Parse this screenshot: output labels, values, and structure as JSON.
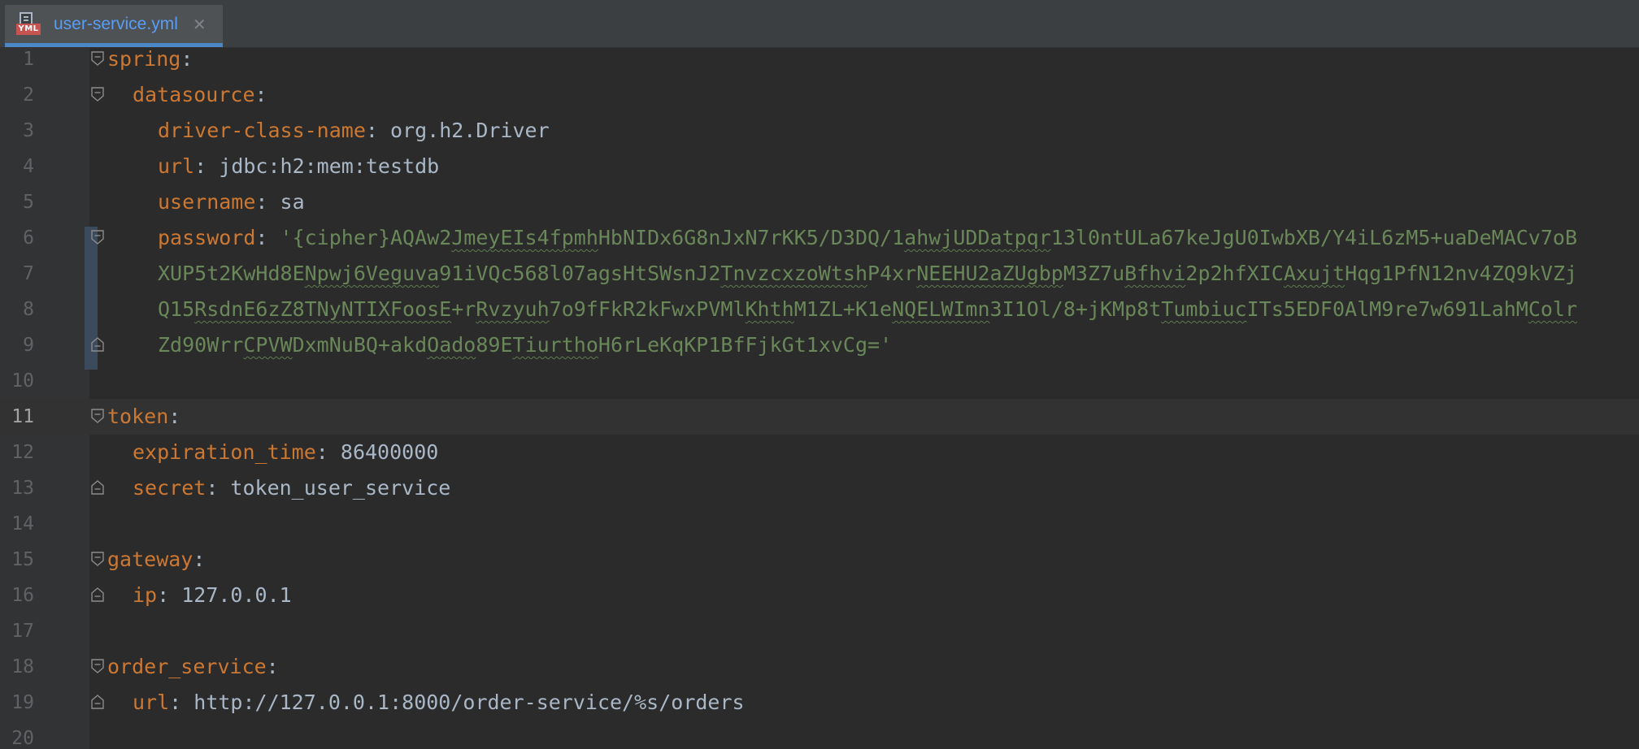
{
  "tab": {
    "icon": "yaml-file-icon",
    "icon_badge": "YML",
    "filename": "user-service.yml",
    "close_glyph": "✕"
  },
  "colors": {
    "key": "#cc7832",
    "value": "#a9b7c6",
    "string": "#6a8759",
    "line_number": "#606366",
    "tab_label": "#589df6",
    "tab_underline": "#4a88c7"
  },
  "editor": {
    "current_line": 11,
    "lines": [
      {
        "n": "1",
        "indent": 0,
        "key": "spring",
        "sep": ":",
        "value": "",
        "type": "map",
        "fold": "open"
      },
      {
        "n": "2",
        "indent": 1,
        "key": "datasource",
        "sep": ":",
        "value": "",
        "type": "map",
        "fold": "open"
      },
      {
        "n": "3",
        "indent": 2,
        "key": "driver-class-name",
        "sep": ": ",
        "value": "org.h2.Driver",
        "type": "plain"
      },
      {
        "n": "4",
        "indent": 2,
        "key": "url",
        "sep": ": ",
        "value": "jdbc:h2:mem:testdb",
        "type": "plain"
      },
      {
        "n": "5",
        "indent": 2,
        "key": "username",
        "sep": ": ",
        "value": "sa",
        "type": "plain"
      },
      {
        "n": "6",
        "indent": 2,
        "key": "password",
        "sep": ": ",
        "value": "'{cipher}AQAw2JmeyEIs4fpmhHbNIDx6G8nJxN7rKK5/D3DQ/1ahwjUDDatpqr13l0ntULa67keJgU0IwbXB/Y4iL6zM5+uaDeMACv7oB",
        "type": "string",
        "fold": "open"
      },
      {
        "n": "7",
        "indent": 2,
        "key": "",
        "sep": "",
        "value": "XUP5t2KwHd8ENpwj6Veguva91iVQc568l07agsHtSWsnJ2TnvzcxzoWtshP4xrNEEHU2aZUgbpM3Z7uBfhvi2p2hfXICAxujtHqg1PfN12nv4ZQ9kVZj",
        "type": "string"
      },
      {
        "n": "8",
        "indent": 2,
        "key": "",
        "sep": "",
        "value": "Q15RsdnE6zZ8TNyNTIXFoosE+rRvzyuh7o9fFkR2kFwxPVMlKhthM1ZL+K1eNQELWImn3I1Ol/8+jKMp8tTumbiucITs5EDF0AlM9re7w691LahMColr",
        "type": "string"
      },
      {
        "n": "9",
        "indent": 2,
        "key": "",
        "sep": "",
        "value": "Zd90WrrCPVWDxmNuBQ+akdOado89ETiurthoH6rLeKqKP1BfFjkGt1xvCg='",
        "type": "string",
        "fold": "close"
      },
      {
        "n": "10",
        "indent": 0,
        "key": "",
        "sep": "",
        "value": "",
        "type": "blank"
      },
      {
        "n": "11",
        "indent": 0,
        "key": "token",
        "sep": ":",
        "value": "",
        "type": "map",
        "fold": "open"
      },
      {
        "n": "12",
        "indent": 1,
        "key": "expiration_time",
        "sep": ": ",
        "value": "86400000",
        "type": "plain"
      },
      {
        "n": "13",
        "indent": 1,
        "key": "secret",
        "sep": ": ",
        "value": "token_user_service",
        "type": "plain",
        "fold": "close"
      },
      {
        "n": "14",
        "indent": 0,
        "key": "",
        "sep": "",
        "value": "",
        "type": "blank"
      },
      {
        "n": "15",
        "indent": 0,
        "key": "gateway",
        "sep": ":",
        "value": "",
        "type": "map",
        "fold": "open"
      },
      {
        "n": "16",
        "indent": 1,
        "key": "ip",
        "sep": ": ",
        "value": "127.0.0.1",
        "type": "plain",
        "fold": "close"
      },
      {
        "n": "17",
        "indent": 0,
        "key": "",
        "sep": "",
        "value": "",
        "type": "blank"
      },
      {
        "n": "18",
        "indent": 0,
        "key": "order_service",
        "sep": ":",
        "value": "",
        "type": "map",
        "fold": "open"
      },
      {
        "n": "19",
        "indent": 1,
        "key": "url",
        "sep": ": ",
        "value": "http://127.0.0.1:8000/order-service/%s/orders",
        "type": "plain",
        "fold": "close"
      },
      {
        "n": "20",
        "indent": 0,
        "key": "",
        "sep": "",
        "value": "",
        "type": "blank"
      }
    ]
  }
}
